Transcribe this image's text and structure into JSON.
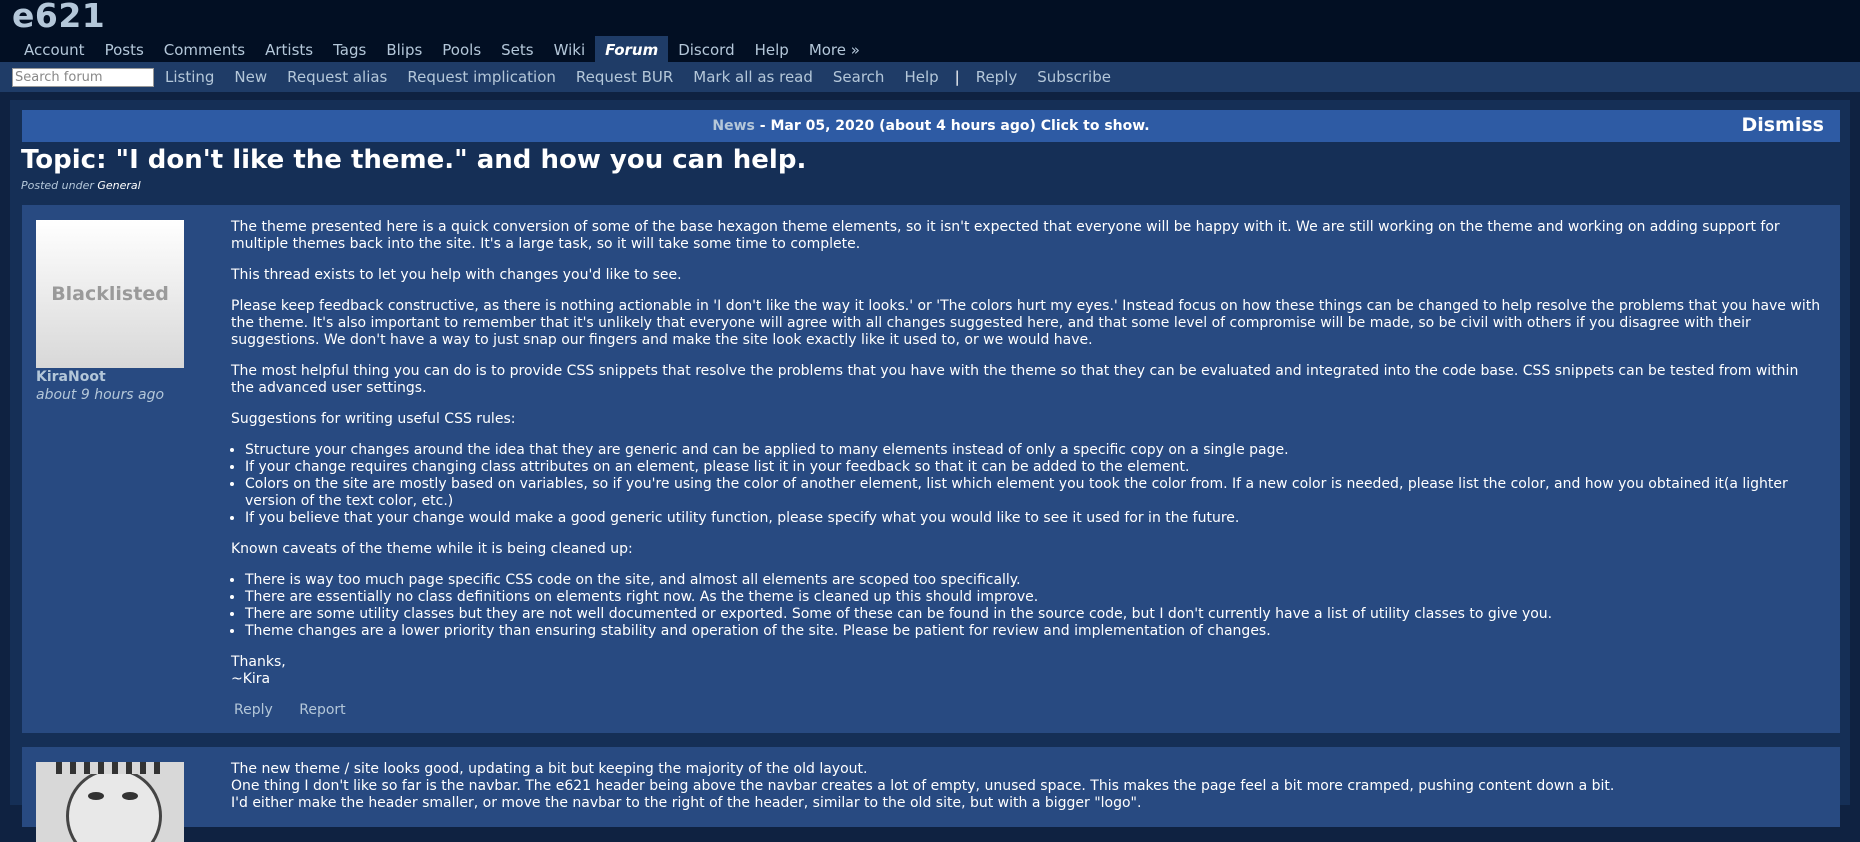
{
  "header": {
    "logo": "e621",
    "nav": [
      {
        "label": "Account"
      },
      {
        "label": "Posts"
      },
      {
        "label": "Comments"
      },
      {
        "label": "Artists"
      },
      {
        "label": "Tags"
      },
      {
        "label": "Blips"
      },
      {
        "label": "Pools"
      },
      {
        "label": "Sets"
      },
      {
        "label": "Wiki"
      },
      {
        "label": "Forum",
        "active": true
      },
      {
        "label": "Discord"
      },
      {
        "label": "Help"
      },
      {
        "label": "More »"
      }
    ]
  },
  "subnav": {
    "search_placeholder": "Search forum",
    "links": [
      "Listing",
      "New",
      "Request alias",
      "Request implication",
      "Request BUR",
      "Mark all as read",
      "Search",
      "Help"
    ],
    "separator": "|",
    "links_after": [
      "Reply",
      "Subscribe"
    ]
  },
  "news": {
    "label": "News",
    "text": " - Mar 05, 2020 (about 4 hours ago) Click to show.",
    "dismiss": "Dismiss"
  },
  "topic": {
    "title": "Topic: \"I don't like the theme.\" and how you can help.",
    "posted_under_prefix": "Posted under ",
    "category": "General"
  },
  "post1": {
    "avatar_text": "Blacklisted",
    "author": "KiraNoot",
    "time": "about 9 hours ago",
    "p1": "The theme presented here is a quick conversion of some of the base hexagon theme elements, so it isn't expected that everyone will be happy with it. We are still working on the theme and working on adding support for multiple themes back into the site. It's a large task, so it will take some time to complete.",
    "p2": "This thread exists to let you help with changes you'd like to see.",
    "p3": "Please keep feedback constructive, as there is nothing actionable in 'I don't like the way it looks.' or 'The colors hurt my eyes.' Instead focus on how these things can be changed to help resolve the problems that you have with the theme. It's also important to remember that it's unlikely that everyone will agree with all changes suggested here, and that some level of compromise will be made, so be civil with others if you disagree with their suggestions. We don't have a way to just snap our fingers and make the site look exactly like it used to, or we would have.",
    "p4": "The most helpful thing you can do is to provide CSS snippets that resolve the problems that you have with the theme so that they can be evaluated and integrated into the code base. CSS snippets can be tested from within the advanced user settings.",
    "p5": "Suggestions for writing useful CSS rules:",
    "list1": [
      "Structure your changes around the idea that they are generic and can be applied to many elements instead of only a specific copy on a single page.",
      "If your change requires changing class attributes on an element, please list it in your feedback so that it can be added to the element.",
      "Colors on the site are mostly based on variables, so if you're using the color of another element, list which element you took the color from. If a new color is needed, please list the color, and how you obtained it(a lighter version of the text color, etc.)",
      "If you believe that your change would make a good generic utility function, please specify what you would like to see it used for in the future."
    ],
    "p6": "Known caveats of the theme while it is being cleaned up:",
    "list2": [
      "There is way too much page specific CSS code on the site, and almost all elements are scoped too specifically.",
      "There are essentially no class definitions on elements right now. As the theme is cleaned up this should improve.",
      "There are some utility classes but they are not well documented or exported. Some of these can be found in the source code, but I don't currently have a list of utility classes to give you.",
      "Theme changes are a lower priority than ensuring stability and operation of the site. Please be patient for review and implementation of changes."
    ],
    "thanks": "Thanks,",
    "sign": "~Kira",
    "reply": "Reply",
    "report": "Report"
  },
  "post2": {
    "line1": "The new theme / site looks good, updating a bit but keeping the majority of the old layout.",
    "line2": "One thing I don't like so far is the navbar. The e621 header being above the navbar creates a lot of empty, unused space. This makes the page feel a bit more cramped, pushing content down a bit.",
    "line3": "I'd either make the header smaller, or move the navbar to the right of the header, similar to the old site, but with a bigger \"logo\"."
  }
}
